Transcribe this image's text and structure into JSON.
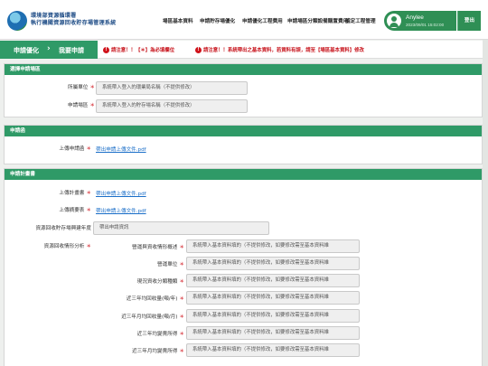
{
  "header": {
    "logo_line1": "環境部資源循環署",
    "logo_line2": "執行機關資源回收貯存場管理系統",
    "nav": [
      "場區基本資料",
      "申請貯存場優化",
      "申請優化工程費用",
      "申請場區分類設備購置費用",
      "稽定工程管理"
    ],
    "user_name": "Anylee",
    "user_time": "2023/09/01 15:02:00",
    "logout_label": "登出"
  },
  "breadcrumb": {
    "parent": "申請優化",
    "current": "我要申請",
    "alert1": "請注意！！【＊】為必填欄位",
    "alert2": "請注意！！系統帶出之基本資料，若資料有誤，請至【場區基本資料】修改"
  },
  "section_select": {
    "title": "選擇申請場區",
    "unit_label": "所屬單位",
    "unit_value": "系統帶入登入的環業局名稱（不提供修改）",
    "site_label": "申請場區",
    "site_value": "系統帶入登入的貯存場名稱（不提供修改）"
  },
  "section_letter": {
    "title": "申請函",
    "upload_label": "上傳申請函",
    "upload_link": "帶出申請上傳文件.pdf"
  },
  "section_plan": {
    "title": "申請計畫書",
    "plan_label": "上傳計畫書",
    "plan_link": "帶出申請上傳文件.pdf",
    "budget_label": "上傳摘要表",
    "budget_link": "帶出申請上傳文件.pdf",
    "year_label": "資源回收貯存場興建年度",
    "year_value": "帶出申請資訊",
    "analysis_label": "資源回收情形分析",
    "analysis_rows": [
      {
        "label": "營運與資收情形概述",
        "value": "系統帶入基本資料填的（不提供修改，如要修改需至基本資料維"
      },
      {
        "label": "營運單位",
        "value": "系統帶入基本資料填的（不提供修改，如要修改需至基本資料維"
      },
      {
        "label": "現況資收分類種類",
        "value": "系統帶入基本資料填的（不提供修改，如要修改需至基本資料維"
      },
      {
        "label": "近三年均回收量(噸/年)",
        "value": "系統帶入基本資料填的（不提供修改，如要修改需至基本資料維"
      },
      {
        "label": "近三年月均回收量(噸/月)",
        "value": "系統帶入基本資料填的（不提供修改，如要修改需至基本資料維"
      },
      {
        "label": "近三年均變賣所得",
        "value": "系統帶入基本資料填的（不提供修改，如要修改需至基本資料維"
      },
      {
        "label": "近三年月均變賣所得",
        "value": "系統帶入基本資料填的（不提供修改，如要修改需至基本資料維"
      }
    ]
  },
  "required_mark": "＊"
}
